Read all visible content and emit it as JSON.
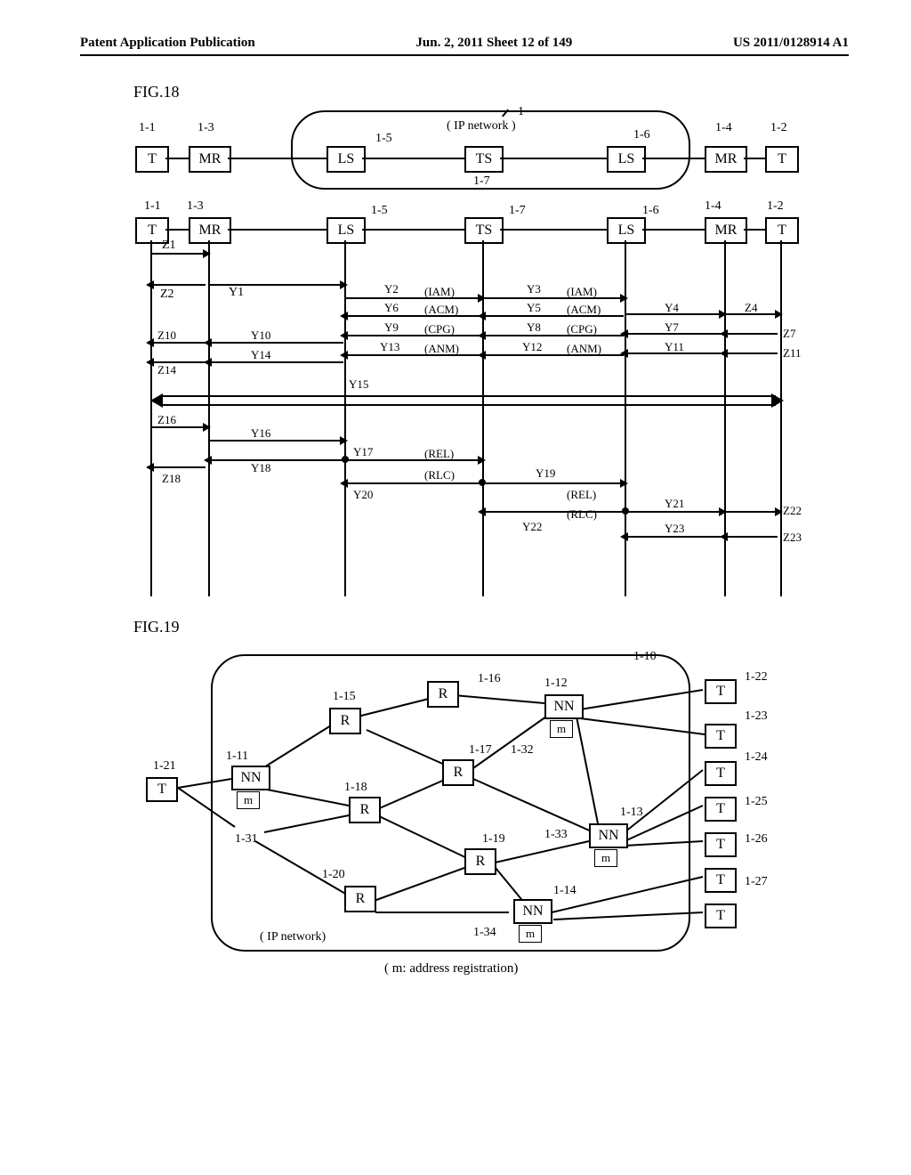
{
  "header": {
    "left": "Patent Application Publication",
    "center": "Jun. 2, 2011  Sheet 12 of 149",
    "right": "US 2011/0128914 A1"
  },
  "fig18": {
    "label": "FIG.18",
    "networkLabel": "( IP network )",
    "nodes": {
      "T": "T",
      "MR": "MR",
      "LS": "LS",
      "TS": "TS"
    },
    "topRefs": [
      "1-1",
      "1-3",
      "1-5",
      "1-7",
      "1-6",
      "1-4",
      "1-2",
      "1"
    ],
    "midRefs": [
      "1-1",
      "1-3",
      "1-5",
      "1-7",
      "1-6",
      "1-4",
      "1-2"
    ],
    "msgs": {
      "IAM": "(IAM)",
      "ACM": "(ACM)",
      "CPG": "(CPG)",
      "ANM": "(ANM)",
      "REL": "(REL)",
      "RLC": "(RLC)"
    },
    "y": [
      "Y1",
      "Y2",
      "Y3",
      "Y4",
      "Y5",
      "Y6",
      "Y7",
      "Y8",
      "Y9",
      "Y10",
      "Y11",
      "Y12",
      "Y13",
      "Y14",
      "Y15",
      "Y16",
      "Y17",
      "Y18",
      "Y19",
      "Y20",
      "Y21",
      "Y22",
      "Y23"
    ],
    "z": [
      "Z1",
      "Z2",
      "Z4",
      "Z7",
      "Z10",
      "Z11",
      "Z14",
      "Z16",
      "Z18",
      "Z22",
      "Z23"
    ]
  },
  "fig19": {
    "label": "FIG.19",
    "networkLabel": "( IP network)",
    "footnote": "( m: address registration)",
    "nodes": {
      "R": "R",
      "NN": "NN",
      "T": "T",
      "m": "m"
    },
    "refs": [
      "1-10",
      "1-11",
      "1-12",
      "1-13",
      "1-14",
      "1-15",
      "1-16",
      "1-17",
      "1-18",
      "1-19",
      "1-20",
      "1-21",
      "1-22",
      "1-23",
      "1-24",
      "1-25",
      "1-26",
      "1-27",
      "1-31",
      "1-32",
      "1-33",
      "1-34"
    ]
  }
}
